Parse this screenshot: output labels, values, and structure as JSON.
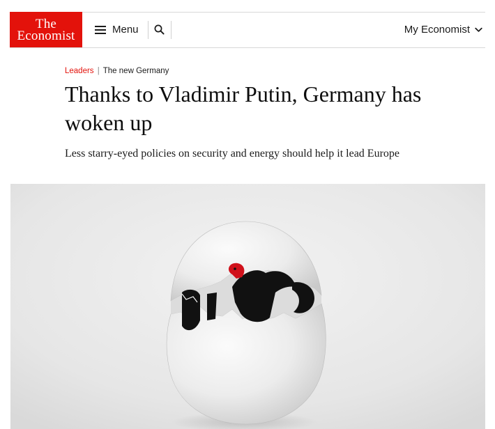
{
  "header": {
    "logo_line1": "The",
    "logo_line2": "Economist",
    "menu_label": "Menu",
    "my_economist_label": "My Economist",
    "icons": [
      "menu-icon",
      "search-icon",
      "chevron-down-icon"
    ],
    "brand_color": "#e3120b"
  },
  "article": {
    "section": "Leaders",
    "separator": "|",
    "flytitle": "The new Germany",
    "headline": "Thanks to Vladimir Putin, Germany has woken up",
    "standfirst": "Less starry-eyed policies on security and energy should help it lead Europe"
  },
  "hero_image": {
    "depicts": "cracked white egg with a black eagle bearing a red beak hatching from it, on a pale grey background"
  }
}
